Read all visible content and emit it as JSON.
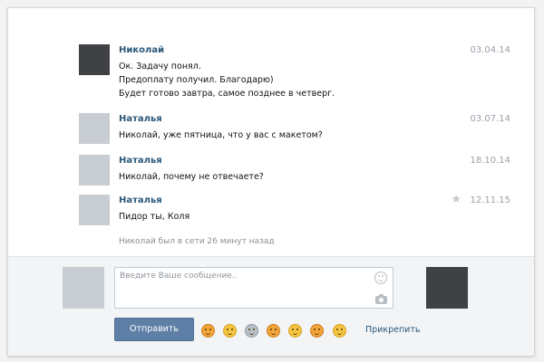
{
  "messages": [
    {
      "author": "Николай",
      "date": "03.04.14",
      "lines": [
        "Ок. Задачу понял.",
        "Предоплату получил. Благодарю)",
        "Будет готово завтра, самое позднее в четверг."
      ]
    },
    {
      "author": "Наталья",
      "date": "03.07.14",
      "lines": [
        "Николай, уже пятница, что у вас с макетом?"
      ]
    },
    {
      "author": "Наталья",
      "date": "18.10.14",
      "lines": [
        "Николай, почему не отвечаете?"
      ]
    },
    {
      "author": "Наталья",
      "date": "12.11.15",
      "lines": [
        "Пидор ты, Коля"
      ]
    }
  ],
  "status_text": "Николай был в сети 26 минут назад",
  "compose": {
    "placeholder": "Введите Ваше сообщение..",
    "send_label": "Отправить",
    "attach_label": "Прикрепить",
    "emojis": [
      "pointing-hand-emoji",
      "grin-emoji",
      "alien-emoji",
      "thumbs-up-emoji",
      "unamused-emoji",
      "cat-emoji",
      "smile-emoji"
    ]
  },
  "colors": {
    "accent": "#5e80a7",
    "author": "#2b587a",
    "date": "#9aa2ab"
  }
}
